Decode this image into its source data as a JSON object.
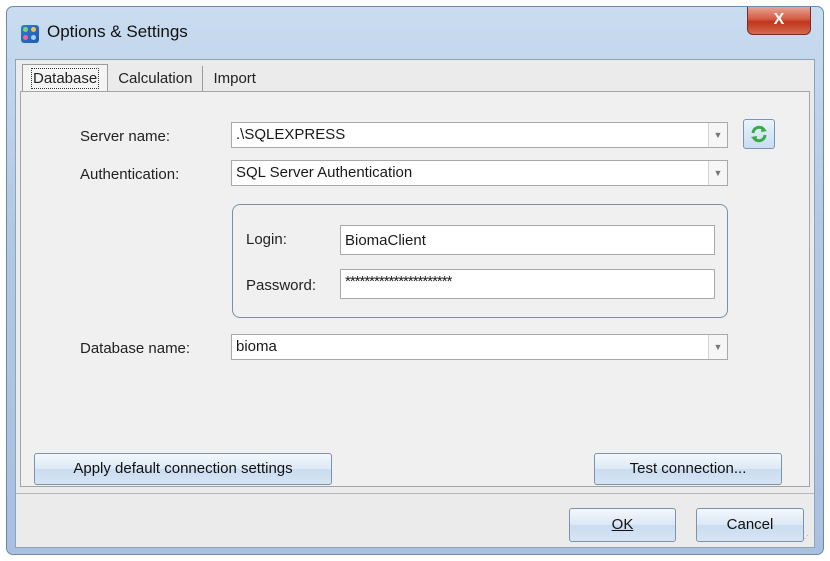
{
  "window": {
    "title": "Options & Settings",
    "close_glyph": "X"
  },
  "tabs": [
    {
      "label": "Database",
      "active": true
    },
    {
      "label": "Calculation",
      "active": false
    },
    {
      "label": "Import",
      "active": false
    }
  ],
  "database": {
    "server_label": "Server name:",
    "server_value": ".\\SQLEXPRESS",
    "auth_label": "Authentication:",
    "auth_value": "SQL Server Authentication",
    "login_label": "Login:",
    "login_value": "BiomaClient",
    "password_label": "Password:",
    "password_value": "**********************",
    "dbname_label": "Database name:",
    "dbname_value": "bioma"
  },
  "buttons": {
    "apply_default": "Apply default connection settings",
    "test_connection": "Test connection...",
    "ok": "OK",
    "cancel": "Cancel"
  },
  "icons": {
    "app": "app-grid-icon",
    "refresh": "refresh-icon",
    "dropdown": "chevron-down-icon"
  },
  "colors": {
    "title_bar": "#b8cfe8",
    "close_button": "#c83c24",
    "refresh_arrows": "#3aa845"
  }
}
